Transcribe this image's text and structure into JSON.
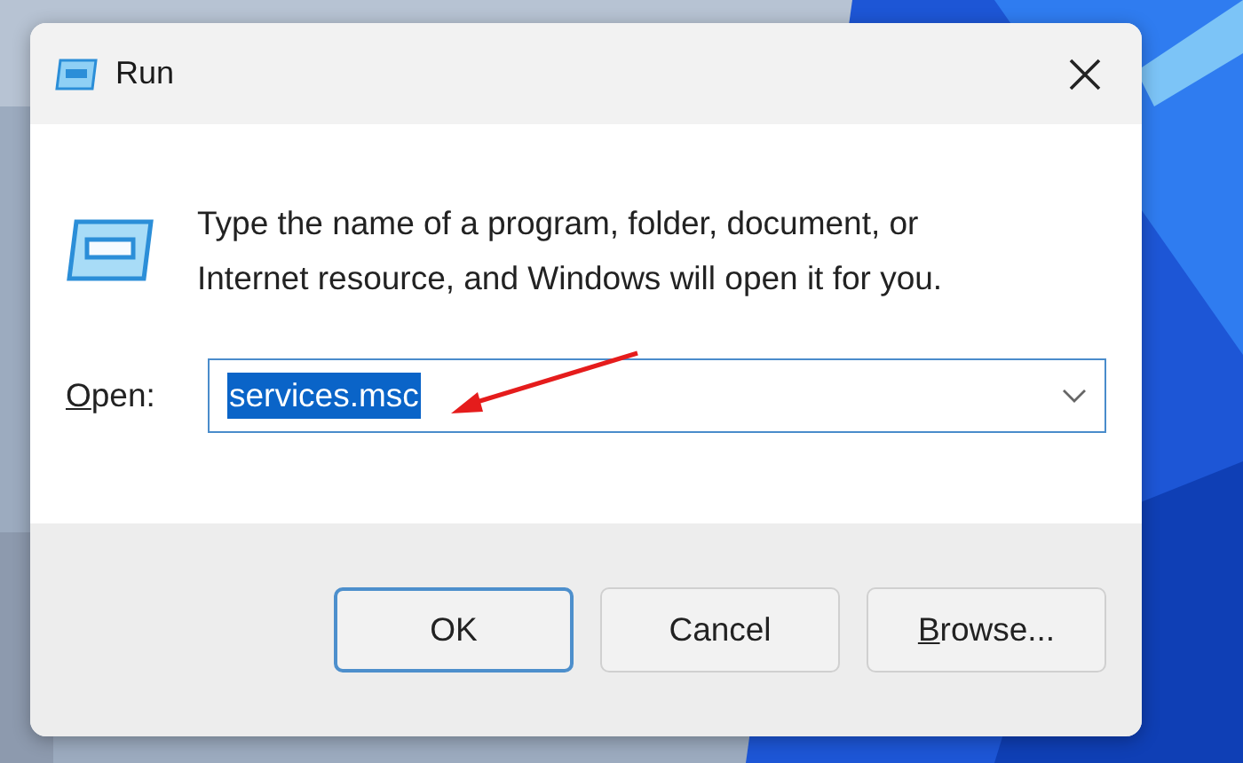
{
  "window": {
    "title": "Run"
  },
  "description": "Type the name of a program, folder, document, or Internet resource, and Windows will open it for you.",
  "open_field": {
    "label": "Open:",
    "label_underline_first": true,
    "value": "services.msc",
    "text_selected": true
  },
  "buttons": [
    {
      "label": "OK",
      "default": true,
      "underline_first": false
    },
    {
      "label": "Cancel",
      "default": false,
      "underline_first": false
    },
    {
      "label": "Browse...",
      "default": false,
      "underline_first": true
    }
  ]
}
